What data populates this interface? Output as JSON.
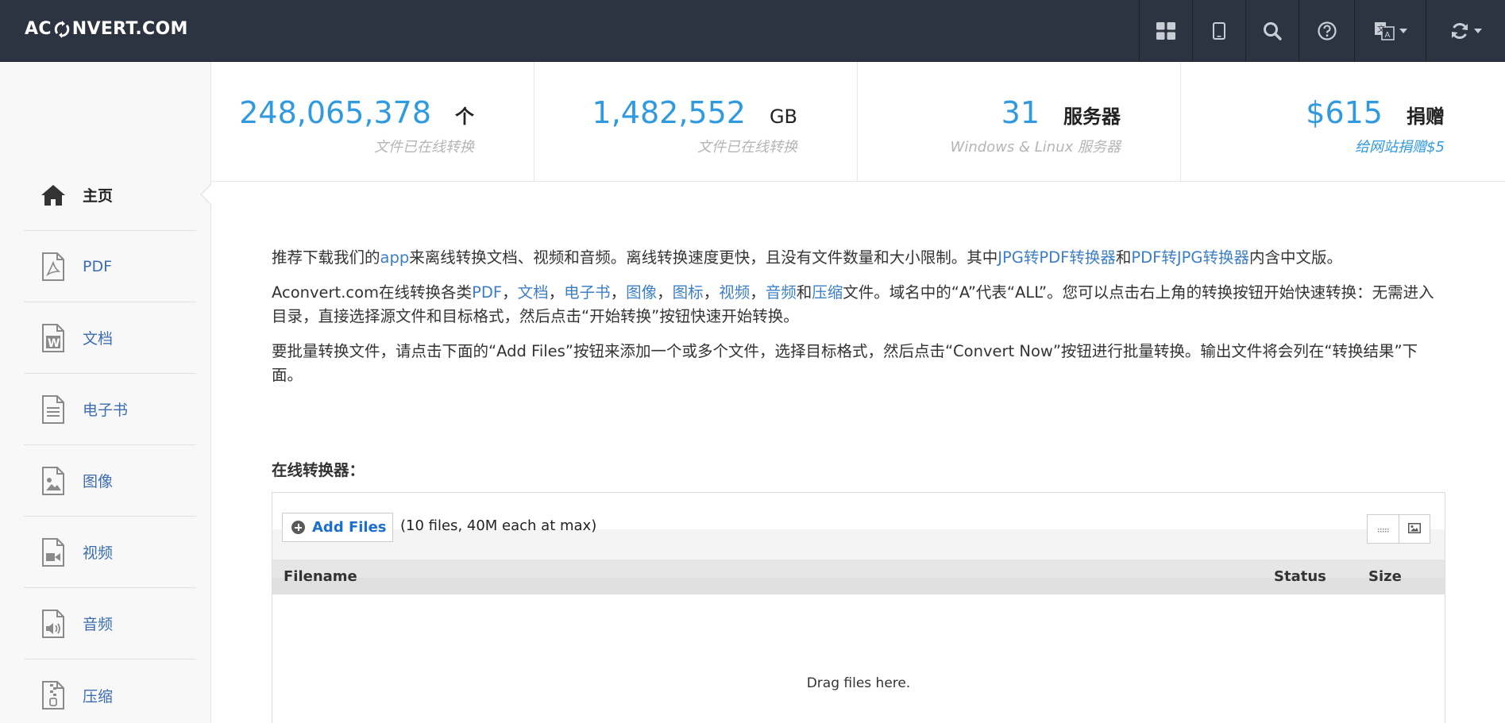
{
  "header": {
    "brand_left": "AC",
    "brand_right": "NVERT.COM",
    "icons": [
      "apps-grid-icon",
      "tablet-icon",
      "search-icon",
      "help-icon",
      "language-icon",
      "refresh-icon"
    ]
  },
  "sidebar": {
    "items": [
      {
        "label": "主页",
        "icon": "home-icon",
        "active": true
      },
      {
        "label": "PDF",
        "icon": "pdf-file-icon"
      },
      {
        "label": "文档",
        "icon": "word-file-icon"
      },
      {
        "label": "电子书",
        "icon": "ebook-file-icon"
      },
      {
        "label": "图像",
        "icon": "image-file-icon"
      },
      {
        "label": "视频",
        "icon": "video-file-icon"
      },
      {
        "label": "音频",
        "icon": "audio-file-icon"
      },
      {
        "label": "压缩",
        "icon": "archive-file-icon"
      }
    ]
  },
  "stats": [
    {
      "num": "248,065,378",
      "unit": "个",
      "sub": "文件已在线转换"
    },
    {
      "num": "1,482,552",
      "unit": "GB",
      "sub": "文件已在线转换"
    },
    {
      "num": "31",
      "unit": "服务器",
      "sub": "Windows & Linux 服务器"
    },
    {
      "num": "$615",
      "unit": "捐赠",
      "sub": "给网站捐赠$5"
    }
  ],
  "intro": {
    "p1": {
      "t1": "推荐下载我们的",
      "link_app": "app",
      "t2": "来离线转换文档、视频和音频。离线转换速度更快，且没有文件数量和大小限制。其中",
      "link_jpg_pdf": "JPG转PDF转换器",
      "t3": "和",
      "link_pdf_jpg": "PDF转JPG转换器",
      "t4": "内含中文版。"
    },
    "p2": {
      "t1": "Aconvert.com在线转换各类",
      "links": [
        "PDF",
        "文档",
        "电子书",
        "图像",
        "图标",
        "视频",
        "音频",
        "压缩"
      ],
      "sep": "，",
      "and": "和",
      "t2": "文件。域名中的“A”代表“ALL”。您可以点击右上角的转换按钮开始快速转换：无需进入目录，直接选择源文件和目标格式，然后点击“开始转换”按钮快速开始转换。"
    },
    "p3": "要批量转换文件，请点击下面的“Add Files”按钮来添加一个或多个文件，选择目标格式，然后点击“Convert Now”按钮进行批量转换。输出文件将会列在“转换结果”下面。"
  },
  "converter": {
    "title": "在线转换器：",
    "add_files_label": "Add Files",
    "limits": "(10 files, 40M each at max)",
    "columns": [
      "Filename",
      "Status",
      "Size"
    ],
    "drop_text": "Drag files here."
  },
  "colors": {
    "header_bg": "#2c3441",
    "accent": "#2f9ae0",
    "link": "#3d7fc7"
  }
}
